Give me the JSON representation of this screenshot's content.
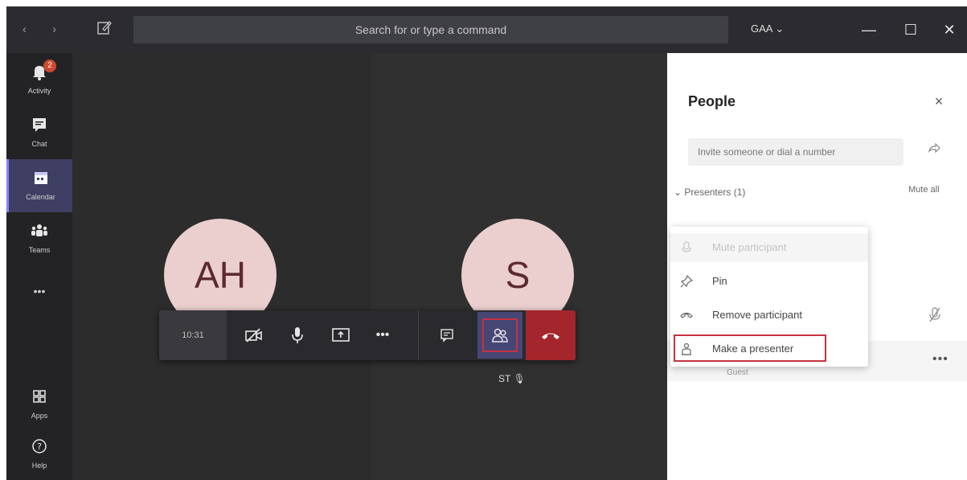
{
  "titlebar": {
    "search_placeholder": "Search for or type a command",
    "tenant": "GAA ⌄",
    "minimize": "—",
    "maximize": "☐",
    "close": "✕",
    "nav": "‹ ›"
  },
  "appbar": {
    "items": [
      {
        "label": "Activity",
        "icon": "bell-icon",
        "badge": "2"
      },
      {
        "label": "Chat",
        "icon": "chat-icon"
      },
      {
        "label": "Calendar",
        "icon": "calendar-icon",
        "active": true
      },
      {
        "label": "Teams",
        "icon": "teams-icon"
      },
      {
        "label": "•••",
        "icon": "more-icon"
      },
      {
        "label": "Apps",
        "icon": "apps-icon"
      },
      {
        "label": "Help",
        "icon": "help-icon"
      }
    ]
  },
  "stage": {
    "participant_left": "AH",
    "participant_right": "S",
    "caption_right": "ST 🎙"
  },
  "callbar": {
    "timer": "10:31",
    "more": "•••"
  },
  "panel": {
    "title": "People",
    "close": "×",
    "invite_placeholder": "Invite someone or dial a number",
    "presenters_label": "Presenters (1)",
    "mute_all": "Mute all",
    "row_more": "•••",
    "row_name": "Guest"
  },
  "menu": {
    "items": [
      {
        "label": "Mute participant",
        "icon": "mic-icon",
        "disabled": true
      },
      {
        "label": "Pin",
        "icon": "pin-icon"
      },
      {
        "label": "Remove participant",
        "icon": "remove-icon"
      },
      {
        "label": "Make a presenter",
        "icon": "presenter-icon"
      }
    ]
  },
  "colors": {
    "accent": "#464775",
    "hangup": "#a4262c",
    "highlight": "#c73241",
    "avatar_bg": "#ebcfcf"
  }
}
